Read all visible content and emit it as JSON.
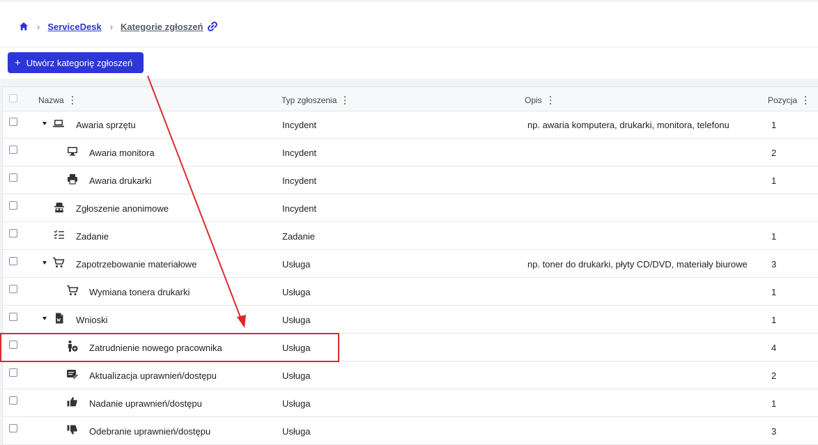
{
  "breadcrumb": {
    "items": [
      "ServiceDesk",
      "Kategorie zgłoszeń"
    ],
    "separator": "›"
  },
  "toolbar": {
    "create_label": "Utwórz kategorię zgłoszeń",
    "create_icon": "plus-icon"
  },
  "table": {
    "columns": [
      "Nazwa",
      "Typ zgłoszenia",
      "Opis",
      "Pozycja"
    ],
    "rows": [
      {
        "name": "Awaria sprzętu",
        "type": "Incydent",
        "description": "np. awaria komputera, drukarki, monitora, telefonu",
        "position": "1",
        "icon": "laptop-icon",
        "expanded": true
      },
      {
        "name": "Awaria monitora",
        "type": "Incydent",
        "description": "",
        "position": "2",
        "icon": "monitor-icon"
      },
      {
        "name": "Awaria drukarki",
        "type": "Incydent",
        "description": "",
        "position": "1",
        "icon": "printer-icon"
      },
      {
        "name": "Zgłoszenie anonimowe",
        "type": "Incydent",
        "description": "",
        "position": "",
        "icon": "incognito-icon"
      },
      {
        "name": "Zadanie",
        "type": "Zadanie",
        "description": "",
        "position": "1",
        "icon": "checklist-icon"
      },
      {
        "name": "Zapotrzebowanie materiałowe",
        "type": "Usługa",
        "description": "np. toner do drukarki, płyty CD/DVD, materiały biurowe",
        "position": "3",
        "icon": "cart-icon",
        "expanded": true
      },
      {
        "name": "Wymiana tonera drukarki",
        "type": "Usługa",
        "description": "",
        "position": "1",
        "icon": "cart-icon"
      },
      {
        "name": "Wnioski",
        "type": "Usługa",
        "description": "",
        "position": "1",
        "icon": "word-document-icon",
        "expanded": true
      },
      {
        "name": "Zatrudnienie nowego pracownika",
        "type": "Usługa",
        "description": "",
        "position": "4",
        "icon": "person-add-icon"
      },
      {
        "name": "Aktualizacja uprawnień/dostępu",
        "type": "Usługa",
        "description": "",
        "position": "2",
        "icon": "edit-note-icon"
      },
      {
        "name": "Nadanie uprawnień/dostępu",
        "type": "Usługa",
        "description": "",
        "position": "1",
        "icon": "thumb-up-icon"
      },
      {
        "name": "Odebranie uprawnień/dostępu",
        "type": "Usługa",
        "description": "",
        "position": "3",
        "icon": "thumb-down-icon"
      }
    ]
  },
  "colors": {
    "accent": "#2d36d6",
    "annotation": "#d92b2b"
  }
}
